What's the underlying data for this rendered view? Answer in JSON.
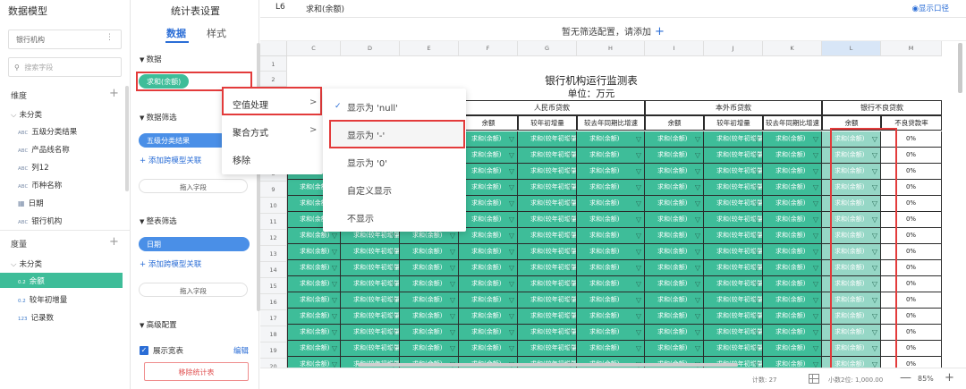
{
  "left_panel": {
    "title": "数据模型",
    "selector": "银行机构",
    "search_placeholder": "搜索字段",
    "dimension_title": "维度",
    "dimension_group": "未分类",
    "dimensions": [
      {
        "type": "ABC",
        "label": "五级分类结果"
      },
      {
        "type": "ABC",
        "label": "产品线名称"
      },
      {
        "type": "ABC",
        "label": "列12"
      },
      {
        "type": "ABC",
        "label": "币种名称"
      },
      {
        "type": "date",
        "label": "日期"
      },
      {
        "type": "ABC",
        "label": "银行机构"
      }
    ],
    "measure_title": "度量",
    "measure_group": "未分类",
    "measures": [
      {
        "type": "0.2",
        "label": "余额"
      },
      {
        "type": "0.2",
        "label": "较年初增量"
      },
      {
        "type": "123",
        "label": "记录数"
      }
    ]
  },
  "config": {
    "title": "统计表设置",
    "tab_data": "数据",
    "tab_style": "样式",
    "data_section": "数据",
    "data_pill": "求和(余额)",
    "filter_section": "数据筛选",
    "filter_pill": "五级分类结果",
    "add_link_1": "添加跨模型关联",
    "drop_1": "拖入字段",
    "table_filter_section": "整表筛选",
    "table_filter_pill": "日期",
    "add_link_2": "添加跨模型关联",
    "drop_2": "拖入字段",
    "advanced_section": "高级配置",
    "show_wide": "展示宽表",
    "edit": "编辑",
    "remove": "移除统计表"
  },
  "topbar": {
    "cell_ref": "L6",
    "formula": "求和(余额)",
    "show_caliber": "显示口径",
    "filter_hint": "暂无筛选配置，请添加",
    "filter_add": "+"
  },
  "context_menu": {
    "items": [
      "空值处理",
      "聚合方式",
      "移除"
    ],
    "arrow": ">"
  },
  "submenu": {
    "check": "✓",
    "items": [
      "显示为 'null'",
      "显示为 '-'",
      "显示为 '0'",
      "自定义显示",
      "不显示"
    ]
  },
  "sheet": {
    "columns": [
      "C",
      "D",
      "E",
      "F",
      "G",
      "H",
      "I",
      "J",
      "K",
      "L",
      "M"
    ],
    "title": "银行机构运行监测表",
    "unit": "单位：万元",
    "group_rmb": "人民币贷款",
    "group_fx": "本外币贷款",
    "group_npl": "银行不良贷款",
    "sub_headers": [
      "余额",
      "较年初增量",
      "较去年同期比增速",
      "余额",
      "较年初增量",
      "较去年同期比增速",
      "余额",
      "不良贷款率"
    ],
    "cell_sum": "求和(余额)",
    "cell_inc": "求和(较年初增量)",
    "cell_pct": "0%"
  },
  "status": {
    "count": "计数: 27",
    "decimal": "小数2位: 1,000.00",
    "zoom": "85%",
    "minus": "—",
    "plus": "+"
  }
}
